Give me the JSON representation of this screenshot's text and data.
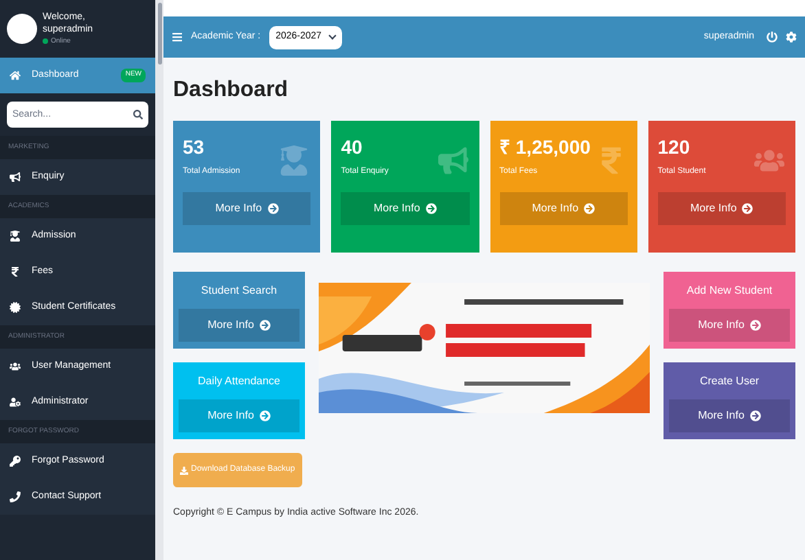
{
  "user_panel": {
    "greeting": "Welcome,",
    "name": "superadmin",
    "status": "Online"
  },
  "sidebar": {
    "items": [
      {
        "kind": "item",
        "label": "Dashboard",
        "badge": "NEW",
        "selected": true
      },
      {
        "kind": "search",
        "placeholder": "Search..."
      },
      {
        "kind": "header",
        "label": "MARKETING"
      },
      {
        "kind": "item",
        "label": "Enquiry",
        "selected": false
      },
      {
        "kind": "header",
        "label": "ACADEMICS"
      },
      {
        "kind": "item",
        "label": "Admission",
        "selected": false
      },
      {
        "kind": "item",
        "label": "Fees",
        "selected": false
      },
      {
        "kind": "item",
        "label": "Student Certificates",
        "selected": false
      },
      {
        "kind": "header",
        "label": "ADMINISTRATOR"
      },
      {
        "kind": "item",
        "label": "User Management",
        "selected": false
      },
      {
        "kind": "item",
        "label": "Administrator",
        "selected": false
      },
      {
        "kind": "header",
        "label": "FORGOT PASSWORD"
      },
      {
        "kind": "item",
        "label": "Forgot Password",
        "selected": false
      },
      {
        "kind": "item",
        "label": "Contact Support",
        "selected": false
      }
    ]
  },
  "topbar": {
    "academic_year_label": "Academic Year :",
    "academic_year": "2026-2027",
    "user": "superadmin"
  },
  "page_title": "Dashboard",
  "stats": [
    {
      "value": "53",
      "label": "Total Admission",
      "link": "More Info",
      "color": "#3c8dbc"
    },
    {
      "value": "40",
      "label": "Total Enquiry",
      "link": "More Info",
      "color": "#00a65a"
    },
    {
      "value": "₹ 1,25,000",
      "label": "Total Fees",
      "link": "More Info",
      "color": "#f39c12"
    },
    {
      "value": "120",
      "label": "Total Student",
      "link": "More Info",
      "color": "#dd4b39"
    }
  ],
  "left_cards": [
    {
      "title": "Student Search",
      "link": "More Info",
      "color": "#3c8dbc"
    },
    {
      "title": "Daily Attendance",
      "link": "More Info",
      "color": "#00c0ef"
    }
  ],
  "right_cards": [
    {
      "title": "Add New Student",
      "link": "More Info",
      "color": "#f06292"
    },
    {
      "title": "Create User",
      "link": "More Info",
      "color": "#605ca8"
    }
  ],
  "backup_button": "Download Database Backup",
  "footer": "Copyright © E Campus by India active Software Inc 2026."
}
